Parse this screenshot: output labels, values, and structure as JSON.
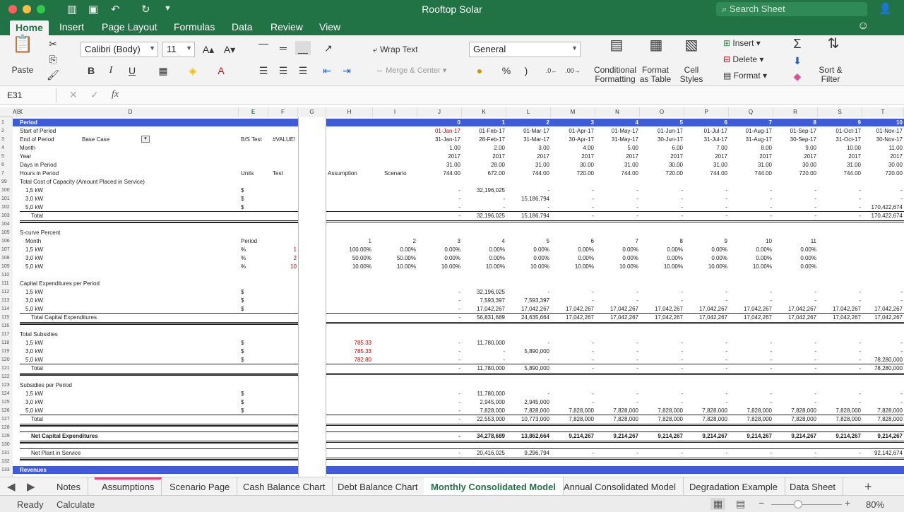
{
  "window": {
    "title": "Rooftop Solar",
    "search_placeholder": "Search Sheet"
  },
  "ribbon_tabs": [
    "Home",
    "Insert",
    "Page Layout",
    "Formulas",
    "Data",
    "Review",
    "View"
  ],
  "ribbon": {
    "paste": "Paste",
    "font_name": "Calibri (Body)",
    "font_size": "11",
    "bold": "B",
    "italic": "I",
    "underline": "U",
    "wrap_text": "Wrap Text",
    "merge_center": "Merge & Center",
    "number_format": "General",
    "percent": "%",
    "comma": ")",
    "cond_format": [
      "Conditional",
      "Formatting"
    ],
    "format_table": [
      "Format",
      "as Table"
    ],
    "cell_styles": [
      "Cell",
      "Styles"
    ],
    "insert": "Insert",
    "delete": "Delete",
    "format": "Format",
    "sort_filter": [
      "Sort &",
      "Filter"
    ]
  },
  "formula_bar": {
    "name_box": "E31",
    "fx": "fx",
    "content": ""
  },
  "columns": [
    "A",
    "B",
    "C",
    "D",
    "E",
    "F",
    "G",
    "H",
    "I",
    "J",
    "K",
    "L",
    "M",
    "N",
    "O",
    "P",
    "Q",
    "R",
    "S",
    "T"
  ],
  "rows_header": [
    {
      "n": "1",
      "label": "Period",
      "band": true,
      "vals": [
        "0",
        "1",
        "2",
        "3",
        "4",
        "5",
        "6",
        "7",
        "8",
        "9",
        "10"
      ]
    },
    {
      "n": "2",
      "label": "Start of Period",
      "vals": [
        "01-Jan-17",
        "01-Feb-17",
        "01-Mar-17",
        "01-Apr-17",
        "01-May-17",
        "01-Jun-17",
        "01-Jul-17",
        "01-Aug-17",
        "01-Sep-17",
        "01-Oct-17",
        "01-Nov-17"
      ],
      "first_red": true
    },
    {
      "n": "3",
      "label": "End of Period",
      "case": "Base Case",
      "e": "B/S Test",
      "f": "#VALUE!",
      "vals": [
        "31-Jan-17",
        "28-Feb-17",
        "31-Mar-17",
        "30-Apr-17",
        "31-May-17",
        "30-Jun-17",
        "31-Jul-17",
        "31-Aug-17",
        "30-Sep-17",
        "31-Oct-17",
        "30-Nov-17"
      ]
    },
    {
      "n": "4",
      "label": "Month",
      "vals": [
        "1.00",
        "2.00",
        "3.00",
        "4.00",
        "5.00",
        "6.00",
        "7.00",
        "8.00",
        "9.00",
        "10.00",
        "11.00"
      ]
    },
    {
      "n": "5",
      "label": "Year",
      "vals": [
        "2017",
        "2017",
        "2017",
        "2017",
        "2017",
        "2017",
        "2017",
        "2017",
        "2017",
        "2017",
        "2017"
      ]
    },
    {
      "n": "6",
      "label": "Days in Period",
      "vals": [
        "31.00",
        "28.00",
        "31.00",
        "30.00",
        "31.00",
        "30.00",
        "31.00",
        "31.00",
        "30.00",
        "31.00",
        "30.00"
      ]
    },
    {
      "n": "7",
      "label": "Hours in Period",
      "e": "Units",
      "f": "Test",
      "h": "Assumption",
      "i": "Scenario",
      "vals": [
        "744.00",
        "672.00",
        "744.00",
        "720.00",
        "744.00",
        "720.00",
        "744.00",
        "744.00",
        "720.00",
        "744.00",
        "720.00"
      ]
    }
  ],
  "rows": [
    {
      "n": "99",
      "label": "Total Cost of Capacity (Amount Placed in Service)",
      "indent": 0
    },
    {
      "n": "100",
      "label": "1,5 kW",
      "indent": 1,
      "e": "$",
      "vals": [
        "-",
        "32,196,025",
        "-",
        "-",
        "-",
        "-",
        "-",
        "-",
        "-",
        "-",
        "-"
      ]
    },
    {
      "n": "101",
      "label": "3,0 kW",
      "indent": 1,
      "e": "$",
      "vals": [
        "-",
        "-",
        "15,186,794",
        "-",
        "-",
        "-",
        "-",
        "-",
        "-",
        "-",
        "-"
      ]
    },
    {
      "n": "102",
      "label": "5,0 kW",
      "indent": 1,
      "e": "$",
      "vals": [
        "-",
        "-",
        "-",
        "-",
        "-",
        "-",
        "-",
        "-",
        "-",
        "-",
        "170,422,674"
      ]
    },
    {
      "n": "103",
      "label": "Total",
      "indent": 2,
      "total": true,
      "vals": [
        "-",
        "32,196,025",
        "15,186,794",
        "-",
        "-",
        "-",
        "-",
        "-",
        "-",
        "-",
        "170,422,674"
      ]
    },
    {
      "n": "104",
      "label": ""
    },
    {
      "n": "105",
      "label": "S-curve Percent",
      "indent": 0
    },
    {
      "n": "106",
      "label": "Month",
      "indent": 1,
      "e": "Period",
      "h": "1",
      "i": "2",
      "hblue": true,
      "vals": [
        "3",
        "4",
        "5",
        "6",
        "7",
        "8",
        "9",
        "10",
        "11",
        "",
        ""
      ]
    },
    {
      "n": "107",
      "label": "1,5 kW",
      "indent": 1,
      "e": "%",
      "f": "1",
      "h": "100.00%",
      "i": "0.00%",
      "vals": [
        "0.00%",
        "0.00%",
        "0.00%",
        "0.00%",
        "0.00%",
        "0.00%",
        "0.00%",
        "0.00%",
        "0.00%",
        "",
        ""
      ]
    },
    {
      "n": "108",
      "label": "3,0 kW",
      "indent": 1,
      "e": "%",
      "f": "2",
      "h": "50.00%",
      "i": "50.00%",
      "vals": [
        "0.00%",
        "0.00%",
        "0.00%",
        "0.00%",
        "0.00%",
        "0.00%",
        "0.00%",
        "0.00%",
        "0.00%",
        "",
        ""
      ]
    },
    {
      "n": "109",
      "label": "5,0 kW",
      "indent": 1,
      "e": "%",
      "f": "10",
      "h": "10.00%",
      "i": "10.00%",
      "vals": [
        "10.00%",
        "10.00%",
        "10.00%",
        "10.00%",
        "10.00%",
        "10.00%",
        "10.00%",
        "10.00%",
        "0.00%",
        "",
        ""
      ]
    },
    {
      "n": "110",
      "label": ""
    },
    {
      "n": "111",
      "label": "Capital Expenditures per Period",
      "indent": 0
    },
    {
      "n": "112",
      "label": "1,5 kW",
      "indent": 1,
      "e": "$",
      "vals": [
        "-",
        "32,196,025",
        "-",
        "-",
        "-",
        "-",
        "-",
        "-",
        "-",
        "-",
        "-"
      ]
    },
    {
      "n": "113",
      "label": "3,0 kW",
      "indent": 1,
      "e": "$",
      "vals": [
        "-",
        "7,593,397",
        "7,593,397",
        "-",
        "-",
        "-",
        "-",
        "-",
        "-",
        "-",
        "-"
      ]
    },
    {
      "n": "114",
      "label": "5,0 kW",
      "indent": 1,
      "e": "$",
      "vals": [
        "-",
        "17,042,267",
        "17,042,267",
        "17,042,267",
        "17,042,267",
        "17,042,267",
        "17,042,267",
        "17,042,267",
        "17,042,267",
        "17,042,267",
        "17,042,267"
      ]
    },
    {
      "n": "115",
      "label": "Total Capital Expenditures",
      "indent": 2,
      "total": true,
      "vals": [
        "-",
        "56,831,689",
        "24,635,664",
        "17,042,267",
        "17,042,267",
        "17,042,267",
        "17,042,267",
        "17,042,267",
        "17,042,267",
        "17,042,267",
        "17,042,267"
      ]
    },
    {
      "n": "116",
      "label": ""
    },
    {
      "n": "117",
      "label": "Total Subsidies",
      "indent": 0
    },
    {
      "n": "118",
      "label": "1,5 kW",
      "indent": 1,
      "e": "$",
      "hred": "785.33",
      "vals": [
        "-",
        "11,780,000",
        "-",
        "-",
        "-",
        "-",
        "-",
        "-",
        "-",
        "-",
        "-"
      ]
    },
    {
      "n": "119",
      "label": "3,0 kW",
      "indent": 1,
      "e": "$",
      "hred": "785.33",
      "vals": [
        "-",
        "-",
        "5,890,000",
        "-",
        "-",
        "-",
        "-",
        "-",
        "-",
        "-",
        "-"
      ]
    },
    {
      "n": "120",
      "label": "5,0 kW",
      "indent": 1,
      "e": "$",
      "hred": "782.80",
      "vals": [
        "-",
        "-",
        "-",
        "-",
        "-",
        "-",
        "-",
        "-",
        "-",
        "-",
        "78,280,000"
      ]
    },
    {
      "n": "121",
      "label": "Total",
      "indent": 2,
      "total": true,
      "vals": [
        "-",
        "11,780,000",
        "5,890,000",
        "-",
        "-",
        "-",
        "-",
        "-",
        "-",
        "-",
        "78,280,000"
      ]
    },
    {
      "n": "122",
      "label": ""
    },
    {
      "n": "123",
      "label": "Subsidies per Period",
      "indent": 0
    },
    {
      "n": "124",
      "label": "1,5 kW",
      "indent": 1,
      "e": "$",
      "vals": [
        "-",
        "11,780,000",
        "-",
        "-",
        "-",
        "-",
        "-",
        "-",
        "-",
        "-",
        "-"
      ]
    },
    {
      "n": "125",
      "label": "3,0 kW",
      "indent": 1,
      "e": "$",
      "vals": [
        "-",
        "2,945,000",
        "2,945,000",
        "-",
        "-",
        "-",
        "-",
        "-",
        "-",
        "-",
        "-"
      ]
    },
    {
      "n": "126",
      "label": "5,0 kW",
      "indent": 1,
      "e": "$",
      "vals": [
        "-",
        "7,828,000",
        "7,828,000",
        "7,828,000",
        "7,828,000",
        "7,828,000",
        "7,828,000",
        "7,828,000",
        "7,828,000",
        "7,828,000",
        "7,828,000"
      ]
    },
    {
      "n": "127",
      "label": "Total",
      "indent": 2,
      "total": true,
      "vals": [
        "-",
        "22,553,000",
        "10,773,000",
        "7,828,000",
        "7,828,000",
        "7,828,000",
        "7,828,000",
        "7,828,000",
        "7,828,000",
        "7,828,000",
        "7,828,000"
      ]
    },
    {
      "n": "128",
      "label": ""
    },
    {
      "n": "129",
      "label": "Net Capital Expenditures",
      "indent": 2,
      "bold": true,
      "total": true,
      "vals": [
        "-",
        "34,278,689",
        "13,862,664",
        "9,214,267",
        "9,214,267",
        "9,214,267",
        "9,214,267",
        "9,214,267",
        "9,214,267",
        "9,214,267",
        "9,214,267"
      ]
    },
    {
      "n": "130",
      "label": ""
    },
    {
      "n": "131",
      "label": "Net Plant in Service",
      "indent": 2,
      "total": true,
      "vals": [
        "-",
        "20,416,025",
        "9,296,794",
        "-",
        "-",
        "-",
        "-",
        "-",
        "-",
        "-",
        "92,142,674"
      ]
    },
    {
      "n": "132",
      "label": ""
    },
    {
      "n": "133",
      "label": "Revenues",
      "band": true
    }
  ],
  "sheet_tabs": [
    "Notes",
    "Assumptions",
    "Scenario Page",
    "Cash Balance Chart",
    "Debt Balance Chart",
    "Monthly Consolidated Model",
    "Annual Consolidated Model",
    "Degradation Example",
    "Data Sheet"
  ],
  "active_sheet": "Monthly Consolidated Model",
  "status": {
    "ready": "Ready",
    "calculate": "Calculate",
    "zoom": "80%"
  },
  "colors": {
    "excel_green": "#217346",
    "band_blue": "#3f5bd8"
  }
}
